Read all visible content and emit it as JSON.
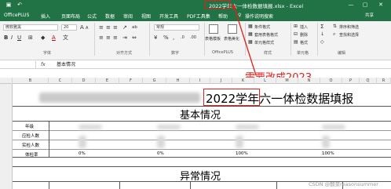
{
  "window": {
    "title": "2022学年六一体检数据填报.xlsx - Excel",
    "minimize_glyph": "—",
    "restore_glyph": "▢",
    "close_glyph": "✕"
  },
  "tabs": {
    "items": [
      "OfficePLUS",
      "插入",
      "页面布局",
      "公式",
      "数据",
      "审阅",
      "视图",
      "开发工具",
      "PDF工具集",
      "帮助"
    ],
    "search_label": "操作说明搜索",
    "share_label": "共享"
  },
  "ribbon": {
    "font_name": "微软雅黑",
    "font_size": "20",
    "number_format": "常规",
    "percent_symbol": "%",
    "comma_symbol": ",",
    "group_font": "字体",
    "group_align": "对齐方式",
    "group_number": "数字",
    "group_officeplus": "OfficePLUS",
    "group_styles": "样式",
    "group_cells": "单元格",
    "group_edit": "编辑",
    "conditional_format": "条件格式",
    "cell_style_apply": "套用表格格式",
    "cell_styles": "单元格样式",
    "table_template": "表格模板",
    "table_beautify": "表格美化",
    "insert": "插入",
    "delete": "删除",
    "format": "格式",
    "find_select": "查找和选择",
    "sort_filter": "排序和筛选",
    "sum_glyph": "Σ",
    "bold": "B",
    "italic": "I",
    "underline": "U",
    "font_color_glyph": "A",
    "wrap_glyph": "ab",
    "merge_glyph": "⇔"
  },
  "formula_bar": {
    "name_box": "",
    "fx": "fx",
    "value": "基本情况"
  },
  "annotation": {
    "text": "需要改成2023",
    "color": "#e0211b"
  },
  "columns": [
    "B",
    "C",
    "D",
    "E",
    "F",
    "G",
    "H",
    "I",
    "J",
    "K",
    "L",
    "M",
    "N",
    "O",
    "P",
    "Q",
    "R"
  ],
  "sheet": {
    "title_highlight": "2022学年",
    "title_rest": "六一体检数据填报",
    "section1": "基本情况",
    "section2": "异常情况",
    "row_labels": [
      "年级",
      "应检人数",
      "实检人数",
      "体检率"
    ],
    "percentages": [
      "0%",
      "0%",
      "100%",
      "100%"
    ]
  },
  "watermark": "CSDN @酸菜reasonsummer"
}
